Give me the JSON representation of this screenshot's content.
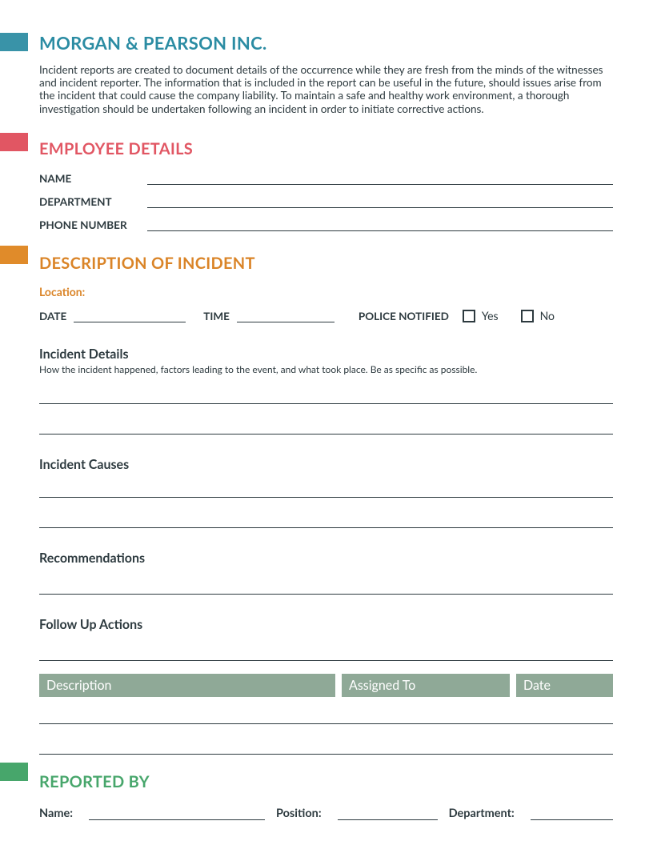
{
  "header": {
    "company": "MORGAN & PEARSON INC.",
    "intro": "Incident reports are created to document details of the occurrence while they are fresh from the minds of the witnesses and incident reporter. The information that is included in the report can be useful in the future, should issues arise from the incident that could cause the company liability. To maintain a safe and healthy work environment, a thorough investigation should be undertaken following an incident in order to initiate corrective actions."
  },
  "employee_section": {
    "title": "EMPLOYEE DETAILS",
    "fields": {
      "name_label": "NAME",
      "department_label": "DEPARTMENT",
      "phone_label": "PHONE NUMBER"
    }
  },
  "incident_section": {
    "title": "DESCRIPTION OF INCIDENT",
    "location_label": "Location:",
    "date_label": "DATE",
    "time_label": "TIME",
    "police_label": "POLICE NOTIFIED",
    "yes_label": "Yes",
    "no_label": "No",
    "details": {
      "heading": "Incident Details",
      "subtext": "How the incident happened, factors leading to the event, and what took place. Be as specific as possible."
    },
    "causes_heading": "Incident Causes",
    "recommendations_heading": "Recommendations",
    "followup_heading": "Follow Up Actions",
    "table": {
      "description": "Description",
      "assigned_to": "Assigned To",
      "date": "Date"
    }
  },
  "reported_section": {
    "title": "REPORTED BY",
    "name_label": "Name:",
    "position_label": "Position:",
    "department_label": "Department:"
  }
}
